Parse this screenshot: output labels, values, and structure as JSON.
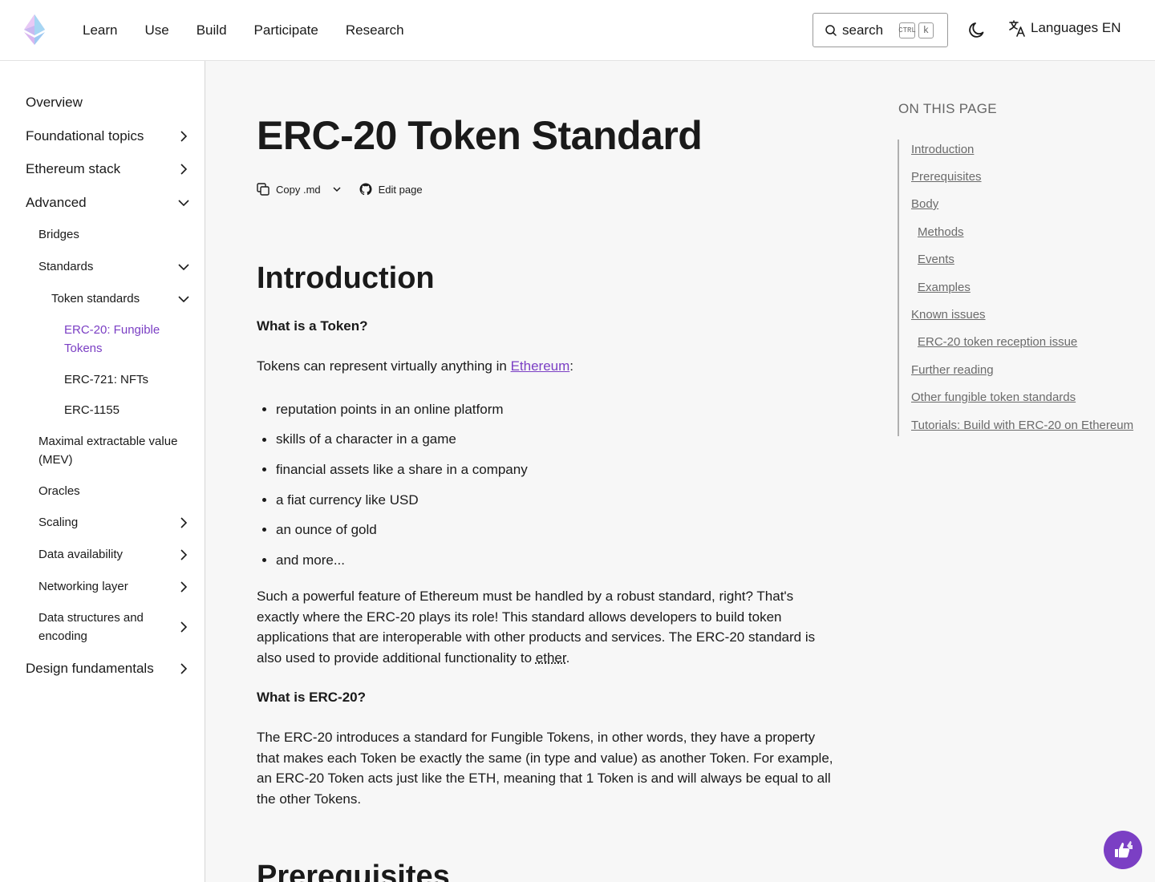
{
  "header": {
    "nav": [
      "Learn",
      "Use",
      "Build",
      "Participate",
      "Research"
    ],
    "search": {
      "label": "search",
      "kbd_ctrl": "CTRL",
      "kbd_key": "k"
    },
    "languages_label": "Languages EN"
  },
  "sidebar": {
    "overview": "Overview",
    "foundational": "Foundational topics",
    "stack": "Ethereum stack",
    "advanced": "Advanced",
    "bridges": "Bridges",
    "standards": "Standards",
    "token_standards": "Token standards",
    "erc20_line1": "ERC-20: Fungible",
    "erc20_line2": "Tokens",
    "erc721": "ERC-721: NFTs",
    "erc1155": "ERC-1155",
    "mev_line1": "Maximal extractable value",
    "mev_line2": "(MEV)",
    "oracles": "Oracles",
    "scaling": "Scaling",
    "data_availability": "Data availability",
    "networking": "Networking layer",
    "ds_line1": "Data structures and",
    "ds_line2": "encoding",
    "design": "Design fundamentals"
  },
  "main": {
    "title": "ERC-20 Token Standard",
    "copy_md": "Copy .md",
    "edit_page": "Edit page",
    "intro_heading": "Introduction",
    "q1": "What is a Token?",
    "p1_before": "Tokens can represent virtually anything in ",
    "p1_link": "Ethereum",
    "p1_after": ":",
    "list": [
      "reputation points in an online platform",
      "skills of a character in a game",
      "financial assets like a share in a company",
      "a fiat currency like USD",
      "an ounce of gold",
      "and more..."
    ],
    "p2_l1": "Such a powerful feature of Ethereum must be handled by a robust standard, right? That's",
    "p2_l2": "exactly where the ERC-20 plays its role! This standard allows developers to build token",
    "p2_l3": "applications that are interoperable with other products and services. The ERC-20 standard is",
    "p2_l4_before": "also used to provide additional functionality to ",
    "p2_l4_term": "ether",
    "p2_l4_after": ".",
    "q2": "What is ERC-20?",
    "p3_l1": "The ERC-20 introduces a standard for Fungible Tokens, in other words, they have a property",
    "p3_l2": "that makes each Token be exactly the same (in type and value) as another Token. For example,",
    "p3_l3": "an ERC-20 Token acts just like the ETH, meaning that 1 Token is and will always be equal to all",
    "p3_l4": "the other Tokens.",
    "prereq_heading": "Prerequisites"
  },
  "toc": {
    "title": "ON THIS PAGE",
    "items": [
      "Introduction",
      "Prerequisites",
      "Body",
      "Methods",
      "Events",
      "Examples",
      "Known issues",
      "ERC-20 token reception issue",
      "Further reading",
      "Other fungible token standards",
      "Tutorials: Build with ERC-20 on Ethereum"
    ]
  },
  "colors": {
    "accent": "#7b3fc4",
    "text": "#1a1a1a",
    "muted": "#6b6b6b",
    "bg": "#f7f7f7"
  }
}
